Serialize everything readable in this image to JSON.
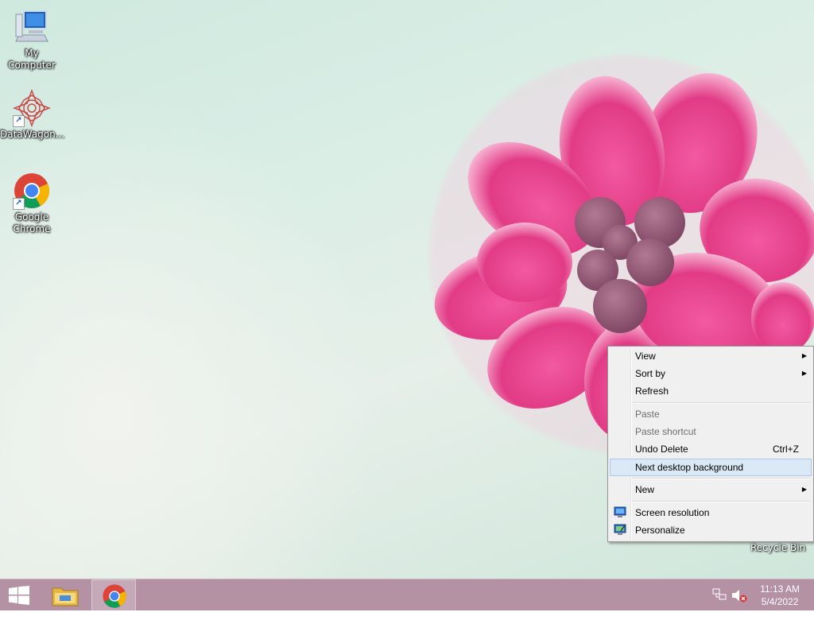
{
  "desktop": {
    "icons": [
      {
        "label": "My Computer",
        "icon": "computer-icon"
      },
      {
        "label": "DataWagon...",
        "icon": "datawagon-icon"
      },
      {
        "label": "Google Chrome",
        "icon": "chrome-icon"
      }
    ],
    "recycle_bin_label": "Recycle Bin"
  },
  "context_menu": {
    "items": [
      {
        "label": "View",
        "submenu": true
      },
      {
        "label": "Sort by",
        "submenu": true
      },
      {
        "label": "Refresh"
      },
      {
        "label": "Paste",
        "disabled": true
      },
      {
        "label": "Paste shortcut",
        "disabled": true
      },
      {
        "label": "Undo Delete",
        "shortcut": "Ctrl+Z"
      },
      {
        "label": "Next desktop background",
        "highlighted": true
      },
      {
        "label": "New",
        "submenu": true
      },
      {
        "label": "Screen resolution",
        "icon": "monitor-icon"
      },
      {
        "label": "Personalize",
        "icon": "personalize-icon"
      }
    ]
  },
  "taskbar": {
    "start": "windows-logo-icon",
    "pinned": [
      "file-explorer-icon",
      "chrome-icon"
    ],
    "tray": {
      "network": "network-icon",
      "volume": "volume-muted-icon"
    },
    "clock": {
      "time": "11:13 AM",
      "date": "5/4/2022"
    },
    "color": "#b591a4"
  }
}
